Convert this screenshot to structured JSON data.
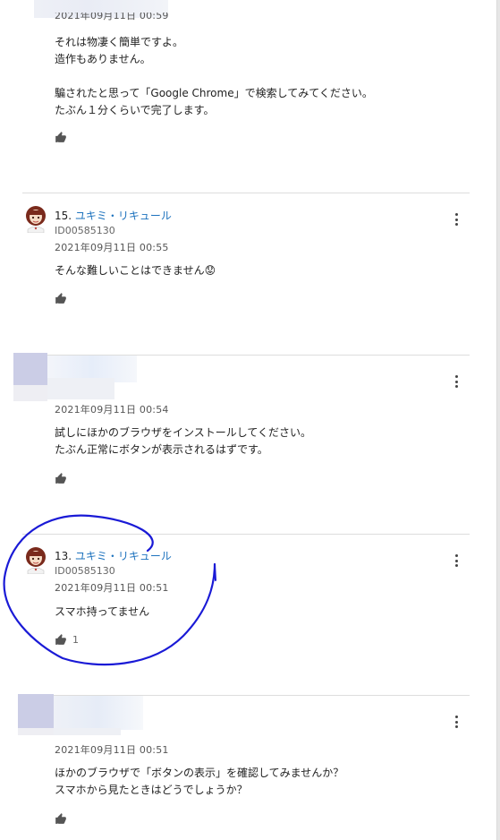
{
  "posts": [
    {
      "date": "2021年09月11日 00:59",
      "body": "それは物凄く簡単ですよ。\n造作もありません。\n\n騙されたと思って「Google Chrome」で検索してみてください。\nたぶん１分くらいで完了します。",
      "like_icon": "thumbs-up-icon"
    },
    {
      "number": "15.",
      "author": "ユキミ・リキュール",
      "user_id": "ID00585130",
      "date": "2021年09月11日 00:55",
      "body": "そんな難しいことはできません😟",
      "like_icon": "thumbs-up-icon"
    },
    {
      "date": "2021年09月11日 00:54",
      "body": "試しにほかのブラウザをインストールしてください。\nたぶん正常にボタンが表示されるはずです。",
      "like_icon": "thumbs-up-icon"
    },
    {
      "number": "13.",
      "author": "ユキミ・リキュール",
      "user_id": "ID00585130",
      "date": "2021年09月11日 00:51",
      "body": "スマホ持ってません",
      "like_icon": "thumbs-up-icon",
      "like_count": "1"
    },
    {
      "date": "2021年09月11日 00:51",
      "body": "ほかのブラウザで「ボタンの表示」を確認してみませんか？\nスマホから見たときはどうでしょうか？",
      "like_icon": "thumbs-up-icon"
    }
  ],
  "menu_icon": "vertical-dots-icon",
  "annotation_color": "#1a1ad6",
  "link_color": "#1e73be"
}
